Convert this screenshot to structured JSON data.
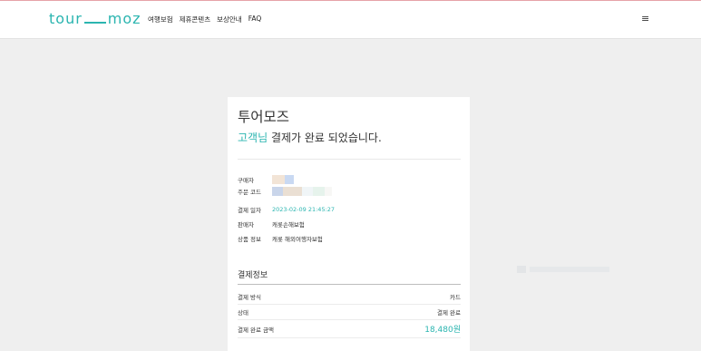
{
  "header": {
    "logo_left": "tour",
    "logo_right": "moz",
    "nav": [
      "여행보험",
      "제휴콘텐츠",
      "보상안내",
      "FAQ"
    ],
    "menu_icon": "hamburger-menu-icon"
  },
  "card": {
    "brand": "투어모즈",
    "message_accent": "고객님",
    "message_rest": " 결제가 완료 되었습니다."
  },
  "order": {
    "buyer_label": "구매자",
    "order_code_label": "주문 코드",
    "payment_date_label": "결제 일자",
    "payment_date_value": "2023-02-09 21:45:27",
    "seller_label": "판매자",
    "seller_value": "캐롯손해보험",
    "product_label": "상품 정보",
    "product_value": "캐롯 해외여행자보험"
  },
  "payment": {
    "title": "결제정보",
    "method_label": "결제 방식",
    "method_value": "카드",
    "status_label": "상태",
    "status_value": "결제 완료",
    "amount_label": "결제 완료 금액",
    "amount_value": "18,480원"
  },
  "colors": {
    "accent": "#2bb5b0",
    "background": "#efefef",
    "top_line": "#e6a3a8"
  }
}
